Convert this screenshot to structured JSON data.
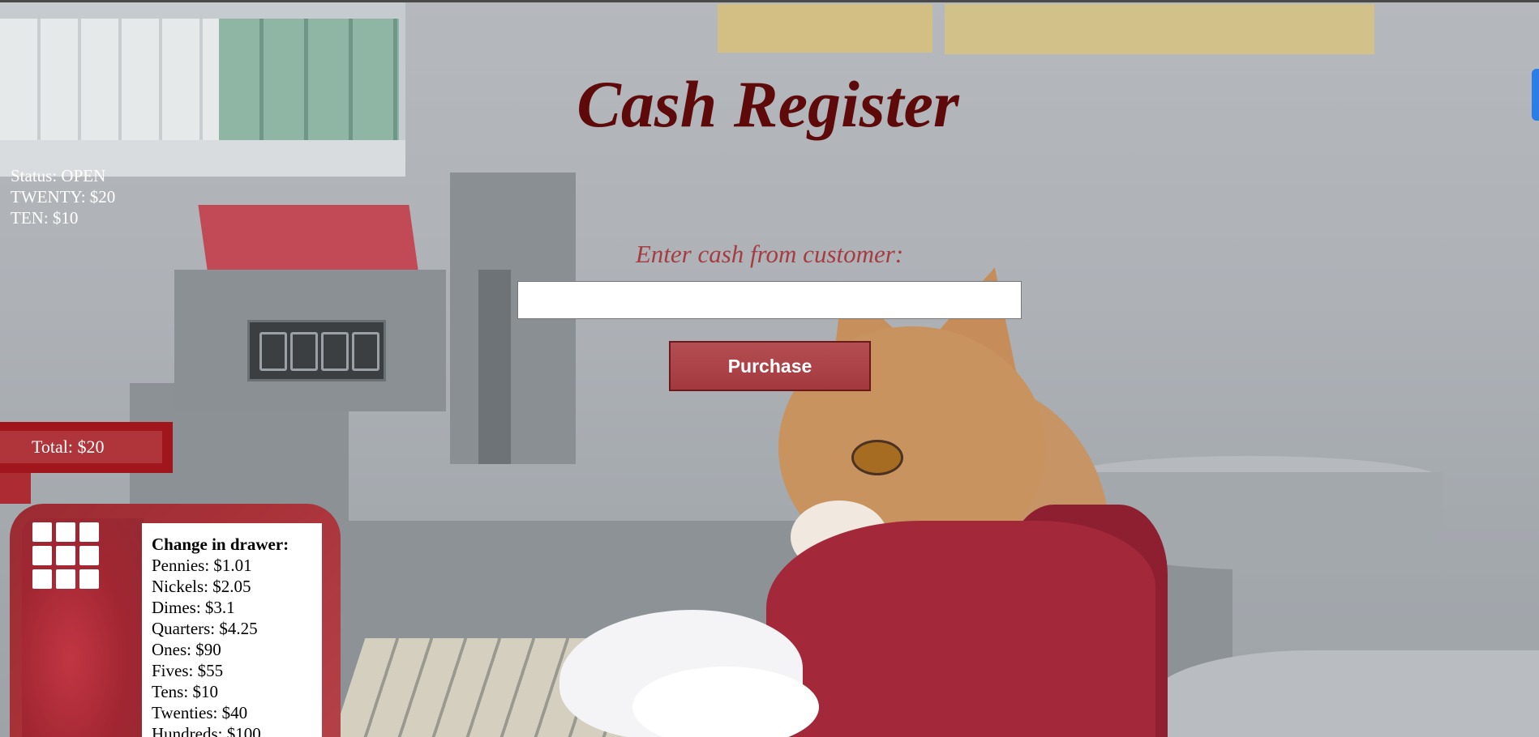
{
  "page": {
    "title": "Cash Register"
  },
  "status_panel": {
    "status": "Status: OPEN",
    "lines": [
      "TWENTY: $20",
      "TEN: $10"
    ]
  },
  "purchase_form": {
    "prompt": "Enter cash from customer:",
    "input_value": "",
    "button_label": "Purchase"
  },
  "total": {
    "label": "Total: $20"
  },
  "drawer": {
    "icon": "grid-icon",
    "heading": "Change in drawer:",
    "items": [
      "Pennies: $1.01",
      "Nickels: $2.05",
      "Dimes: $3.1",
      "Quarters: $4.25",
      "Ones: $90",
      "Fives: $55",
      "Tens: $10",
      "Twenties: $40",
      "Hundreds: $100"
    ]
  },
  "colors": {
    "title": "#5f0a0a",
    "accent": "#a53c42",
    "button": "#a3393f",
    "total_bg": "#a1151c",
    "drawer_bg": "#a83138"
  }
}
